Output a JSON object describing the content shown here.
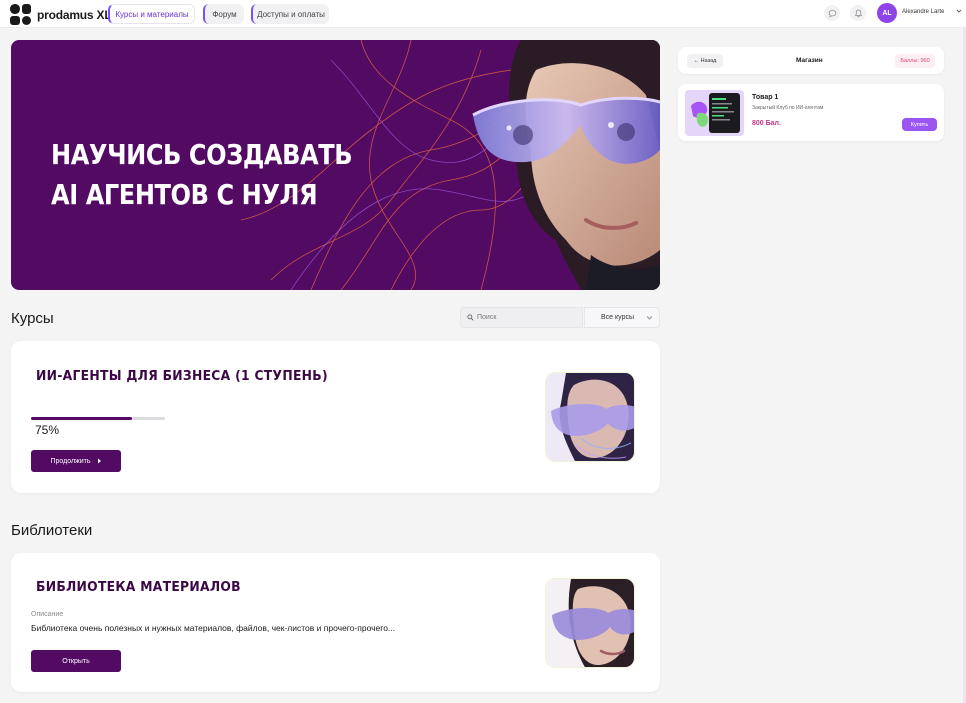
{
  "header": {
    "logo_text": "prodamus XL",
    "tabs": [
      {
        "label": "Курсы и материалы",
        "active": true
      },
      {
        "label": "Форум",
        "active": false
      },
      {
        "label": "Доступы и оплаты",
        "active": false
      }
    ],
    "icons": [
      "chat-icon",
      "bell-icon"
    ],
    "user": {
      "initials": "AL",
      "name": "Alexandre Larte"
    }
  },
  "hero": {
    "line1": "НАУЧИСЬ СОЗДАВАТЬ",
    "line2": "AI АГЕНТОВ С НУЛЯ",
    "background": "#520a63"
  },
  "courses": {
    "title": "Курсы",
    "search_placeholder": "Поиск",
    "filter_value": "Все курсы",
    "items": [
      {
        "title": "ИИ-АГЕНТЫ ДЛЯ БИЗНЕСА (1 СТУПЕНЬ)",
        "progress": 0.75,
        "progress_label": "75%",
        "button_label": "Продолжить"
      }
    ]
  },
  "libraries": {
    "title": "Библиотеки",
    "items": [
      {
        "title": "БИБЛИОТЕКА МАТЕРИАЛОВ",
        "desc_label": "Описание",
        "description": "Библиотека очень полезных и нужных материалов, файлов, чек-листов и прочего-прочего...",
        "button_label": "Открыть"
      }
    ]
  },
  "shop": {
    "back_label": "← Назад",
    "title": "Магазин",
    "points": "Баллы: 960",
    "product": {
      "name": "Товар 1",
      "description": "Закрытый Клуб по ИИ-агентам",
      "price": "800 Бал.",
      "buy_label": "Купить"
    }
  },
  "colors": {
    "brand": "#520a63",
    "accent": "#7c4dff",
    "buy": "#9b55f0",
    "price": "#c2378a"
  }
}
